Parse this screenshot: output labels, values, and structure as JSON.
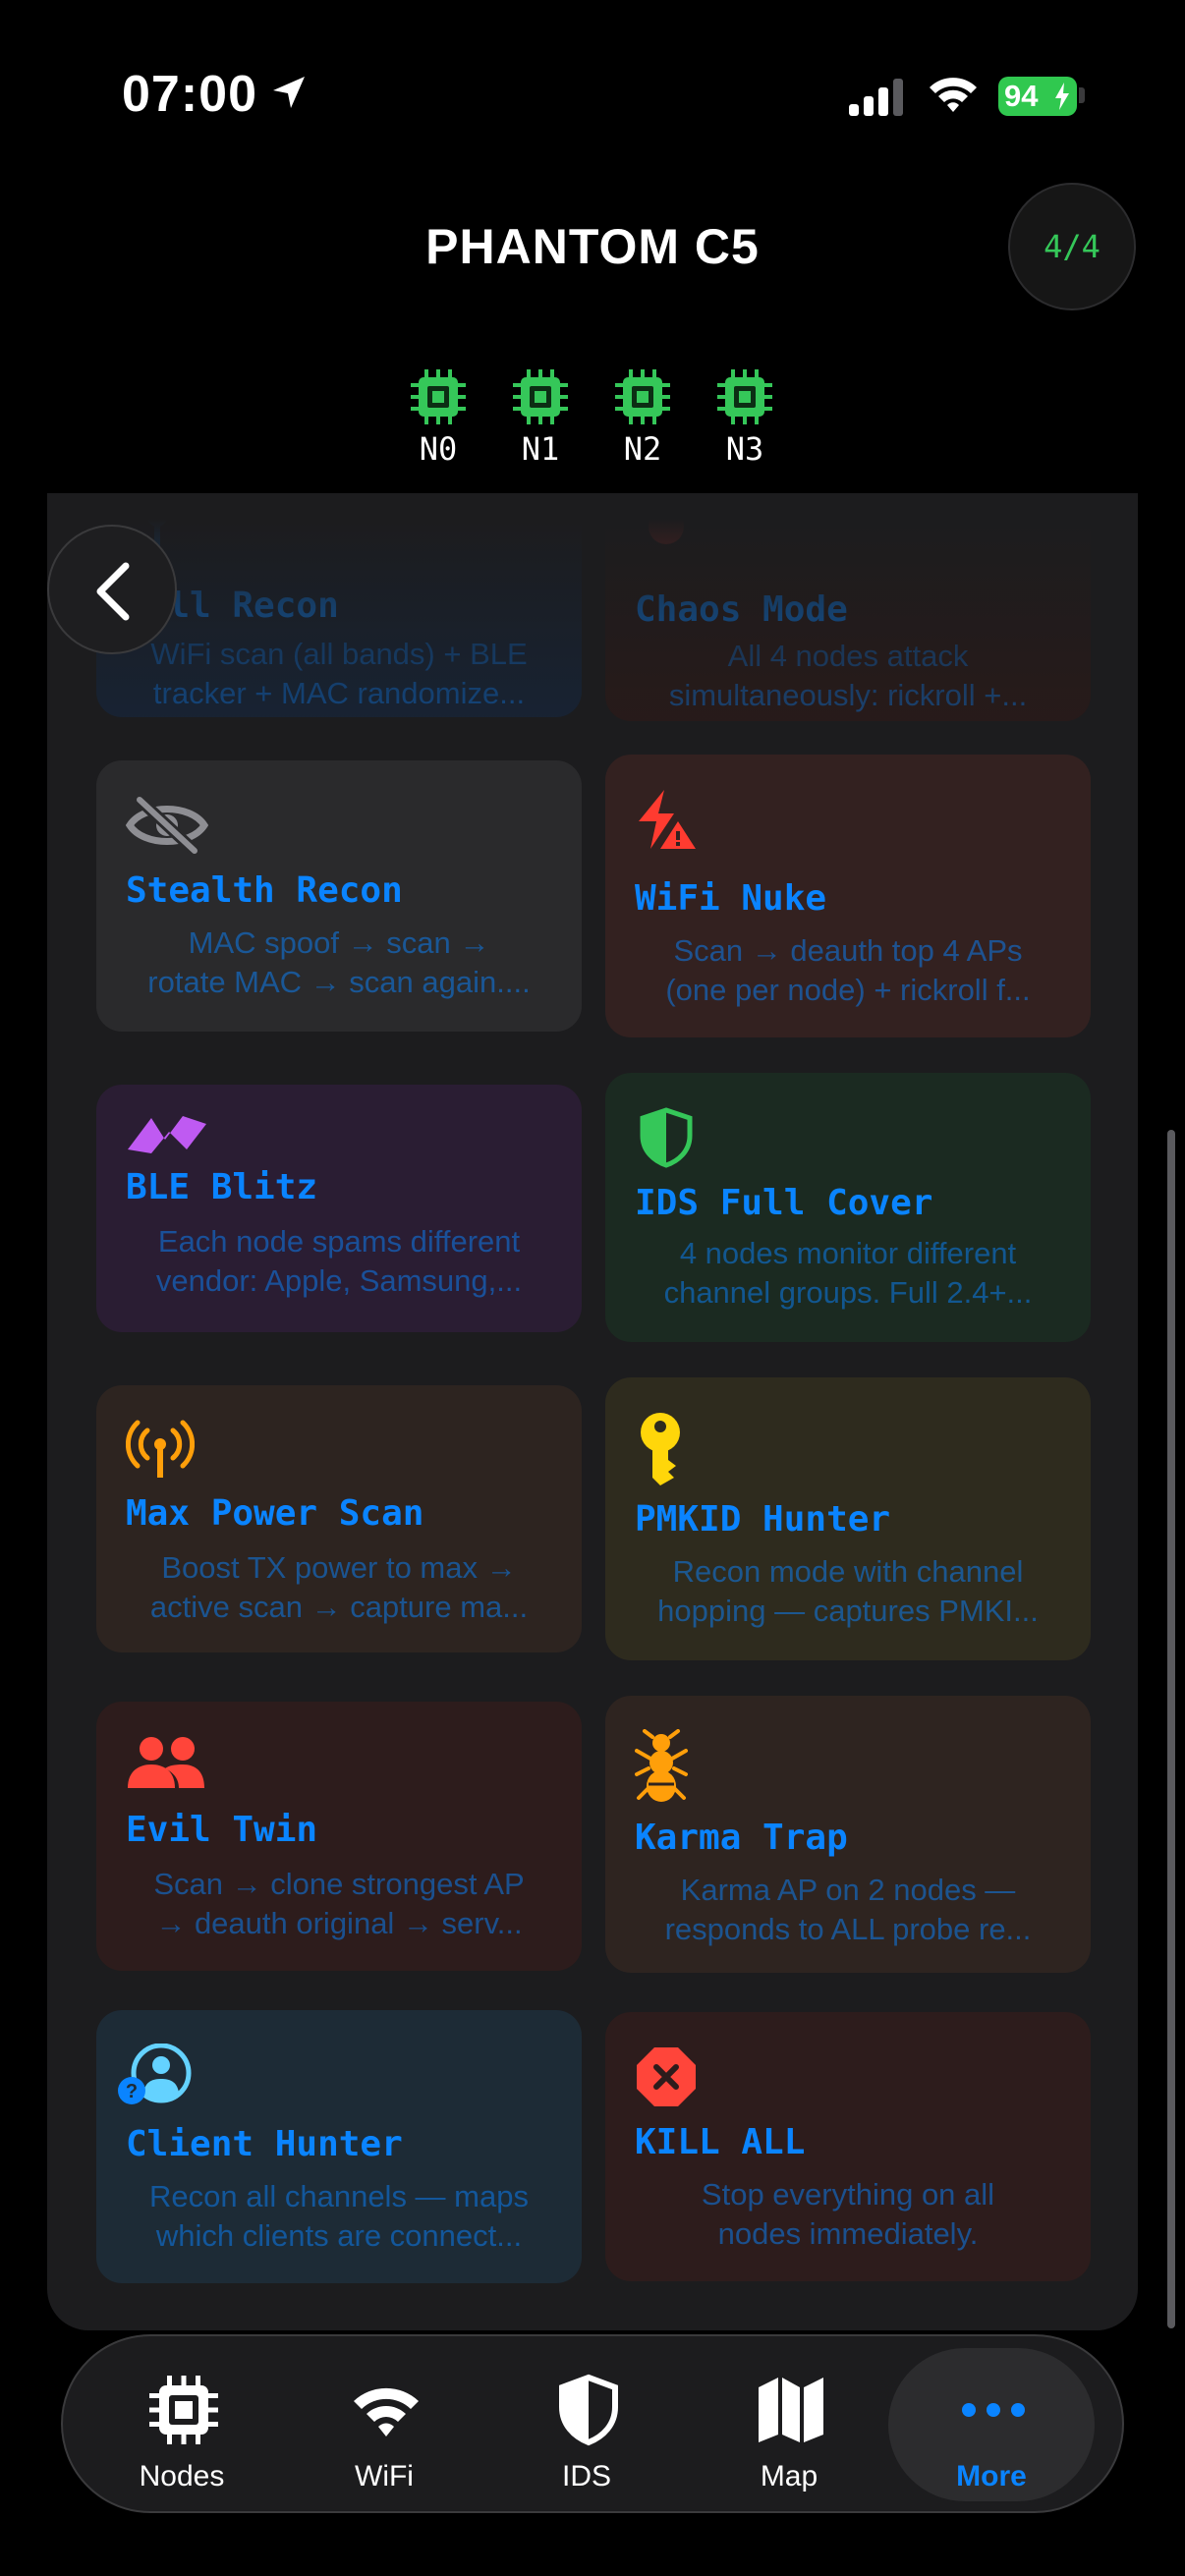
{
  "status": {
    "time": "07:00",
    "battery": "94"
  },
  "header": {
    "title": "PHANTOM C5",
    "node_count": "4/4"
  },
  "nodes": [
    "N0",
    "N1",
    "N2",
    "N3"
  ],
  "colors": {
    "accent": "#0a84ff",
    "node_green": "#35c759",
    "background": "#000000",
    "sheet": "#1c1c1e"
  },
  "cards": [
    {
      "title": "Full Recon",
      "desc": [
        "WiFi scan (all bands) + BLE",
        "tracker + MAC randomize..."
      ],
      "icon": "antenna-icon"
    },
    {
      "title": "Chaos Mode",
      "desc": [
        "All 4 nodes attack",
        "simultaneously: rickroll +..."
      ],
      "icon": "fire-icon"
    },
    {
      "title": "Stealth Recon",
      "desc": [
        "MAC spoof → scan →",
        "rotate MAC → scan again...."
      ],
      "icon": "eye-slash-icon"
    },
    {
      "title": "WiFi Nuke",
      "desc": [
        "Scan → deauth top 4 APs",
        "(one per node) + rickroll f..."
      ],
      "icon": "bolt-warning-icon"
    },
    {
      "title": "BLE Blitz",
      "desc": [
        "Each node spams different",
        "vendor: Apple, Samsung,..."
      ],
      "icon": "waveform-icon"
    },
    {
      "title": "IDS Full Cover",
      "desc": [
        "4 nodes monitor different",
        "channel groups. Full 2.4+..."
      ],
      "icon": "shield-half-icon"
    },
    {
      "title": "Max Power Scan",
      "desc": [
        "Boost TX power to max →",
        "active scan → capture ma..."
      ],
      "icon": "antenna-radiowaves-icon"
    },
    {
      "title": "PMKID Hunter",
      "desc": [
        "Recon mode with channel",
        "hopping — captures PMKI..."
      ],
      "icon": "key-icon"
    },
    {
      "title": "Evil Twin",
      "desc": [
        "Scan → clone strongest AP",
        "→ deauth original → serv..."
      ],
      "icon": "people-icon"
    },
    {
      "title": "Karma Trap",
      "desc": [
        "Karma AP on 2 nodes —",
        "responds to ALL probe re..."
      ],
      "icon": "ant-icon"
    },
    {
      "title": "Client Hunter",
      "desc": [
        "Recon all channels — maps",
        "which clients are connect..."
      ],
      "icon": "person-question-icon"
    },
    {
      "title": "KILL ALL",
      "desc": [
        "Stop everything on all",
        "nodes immediately."
      ],
      "icon": "xmark-octagon-icon"
    }
  ],
  "tabs": [
    {
      "label": "Nodes",
      "icon": "cpu-icon"
    },
    {
      "label": "WiFi",
      "icon": "wifi-icon"
    },
    {
      "label": "IDS",
      "icon": "shield-icon"
    },
    {
      "label": "Map",
      "icon": "map-icon"
    },
    {
      "label": "More",
      "icon": "ellipsis-icon"
    }
  ]
}
